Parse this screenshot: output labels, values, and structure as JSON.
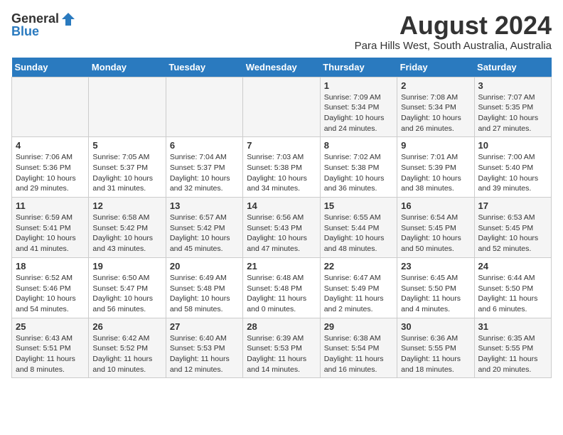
{
  "logo": {
    "line1": "General",
    "line2": "Blue"
  },
  "title": "August 2024",
  "subtitle": "Para Hills West, South Australia, Australia",
  "weekdays": [
    "Sunday",
    "Monday",
    "Tuesday",
    "Wednesday",
    "Thursday",
    "Friday",
    "Saturday"
  ],
  "weeks": [
    [
      {
        "day": "",
        "info": ""
      },
      {
        "day": "",
        "info": ""
      },
      {
        "day": "",
        "info": ""
      },
      {
        "day": "",
        "info": ""
      },
      {
        "day": "1",
        "info": "Sunrise: 7:09 AM\nSunset: 5:34 PM\nDaylight: 10 hours\nand 24 minutes."
      },
      {
        "day": "2",
        "info": "Sunrise: 7:08 AM\nSunset: 5:34 PM\nDaylight: 10 hours\nand 26 minutes."
      },
      {
        "day": "3",
        "info": "Sunrise: 7:07 AM\nSunset: 5:35 PM\nDaylight: 10 hours\nand 27 minutes."
      }
    ],
    [
      {
        "day": "4",
        "info": "Sunrise: 7:06 AM\nSunset: 5:36 PM\nDaylight: 10 hours\nand 29 minutes."
      },
      {
        "day": "5",
        "info": "Sunrise: 7:05 AM\nSunset: 5:37 PM\nDaylight: 10 hours\nand 31 minutes."
      },
      {
        "day": "6",
        "info": "Sunrise: 7:04 AM\nSunset: 5:37 PM\nDaylight: 10 hours\nand 32 minutes."
      },
      {
        "day": "7",
        "info": "Sunrise: 7:03 AM\nSunset: 5:38 PM\nDaylight: 10 hours\nand 34 minutes."
      },
      {
        "day": "8",
        "info": "Sunrise: 7:02 AM\nSunset: 5:38 PM\nDaylight: 10 hours\nand 36 minutes."
      },
      {
        "day": "9",
        "info": "Sunrise: 7:01 AM\nSunset: 5:39 PM\nDaylight: 10 hours\nand 38 minutes."
      },
      {
        "day": "10",
        "info": "Sunrise: 7:00 AM\nSunset: 5:40 PM\nDaylight: 10 hours\nand 39 minutes."
      }
    ],
    [
      {
        "day": "11",
        "info": "Sunrise: 6:59 AM\nSunset: 5:41 PM\nDaylight: 10 hours\nand 41 minutes."
      },
      {
        "day": "12",
        "info": "Sunrise: 6:58 AM\nSunset: 5:42 PM\nDaylight: 10 hours\nand 43 minutes."
      },
      {
        "day": "13",
        "info": "Sunrise: 6:57 AM\nSunset: 5:42 PM\nDaylight: 10 hours\nand 45 minutes."
      },
      {
        "day": "14",
        "info": "Sunrise: 6:56 AM\nSunset: 5:43 PM\nDaylight: 10 hours\nand 47 minutes."
      },
      {
        "day": "15",
        "info": "Sunrise: 6:55 AM\nSunset: 5:44 PM\nDaylight: 10 hours\nand 48 minutes."
      },
      {
        "day": "16",
        "info": "Sunrise: 6:54 AM\nSunset: 5:45 PM\nDaylight: 10 hours\nand 50 minutes."
      },
      {
        "day": "17",
        "info": "Sunrise: 6:53 AM\nSunset: 5:45 PM\nDaylight: 10 hours\nand 52 minutes."
      }
    ],
    [
      {
        "day": "18",
        "info": "Sunrise: 6:52 AM\nSunset: 5:46 PM\nDaylight: 10 hours\nand 54 minutes."
      },
      {
        "day": "19",
        "info": "Sunrise: 6:50 AM\nSunset: 5:47 PM\nDaylight: 10 hours\nand 56 minutes."
      },
      {
        "day": "20",
        "info": "Sunrise: 6:49 AM\nSunset: 5:48 PM\nDaylight: 10 hours\nand 58 minutes."
      },
      {
        "day": "21",
        "info": "Sunrise: 6:48 AM\nSunset: 5:48 PM\nDaylight: 11 hours\nand 0 minutes."
      },
      {
        "day": "22",
        "info": "Sunrise: 6:47 AM\nSunset: 5:49 PM\nDaylight: 11 hours\nand 2 minutes."
      },
      {
        "day": "23",
        "info": "Sunrise: 6:45 AM\nSunset: 5:50 PM\nDaylight: 11 hours\nand 4 minutes."
      },
      {
        "day": "24",
        "info": "Sunrise: 6:44 AM\nSunset: 5:50 PM\nDaylight: 11 hours\nand 6 minutes."
      }
    ],
    [
      {
        "day": "25",
        "info": "Sunrise: 6:43 AM\nSunset: 5:51 PM\nDaylight: 11 hours\nand 8 minutes."
      },
      {
        "day": "26",
        "info": "Sunrise: 6:42 AM\nSunset: 5:52 PM\nDaylight: 11 hours\nand 10 minutes."
      },
      {
        "day": "27",
        "info": "Sunrise: 6:40 AM\nSunset: 5:53 PM\nDaylight: 11 hours\nand 12 minutes."
      },
      {
        "day": "28",
        "info": "Sunrise: 6:39 AM\nSunset: 5:53 PM\nDaylight: 11 hours\nand 14 minutes."
      },
      {
        "day": "29",
        "info": "Sunrise: 6:38 AM\nSunset: 5:54 PM\nDaylight: 11 hours\nand 16 minutes."
      },
      {
        "day": "30",
        "info": "Sunrise: 6:36 AM\nSunset: 5:55 PM\nDaylight: 11 hours\nand 18 minutes."
      },
      {
        "day": "31",
        "info": "Sunrise: 6:35 AM\nSunset: 5:55 PM\nDaylight: 11 hours\nand 20 minutes."
      }
    ]
  ]
}
